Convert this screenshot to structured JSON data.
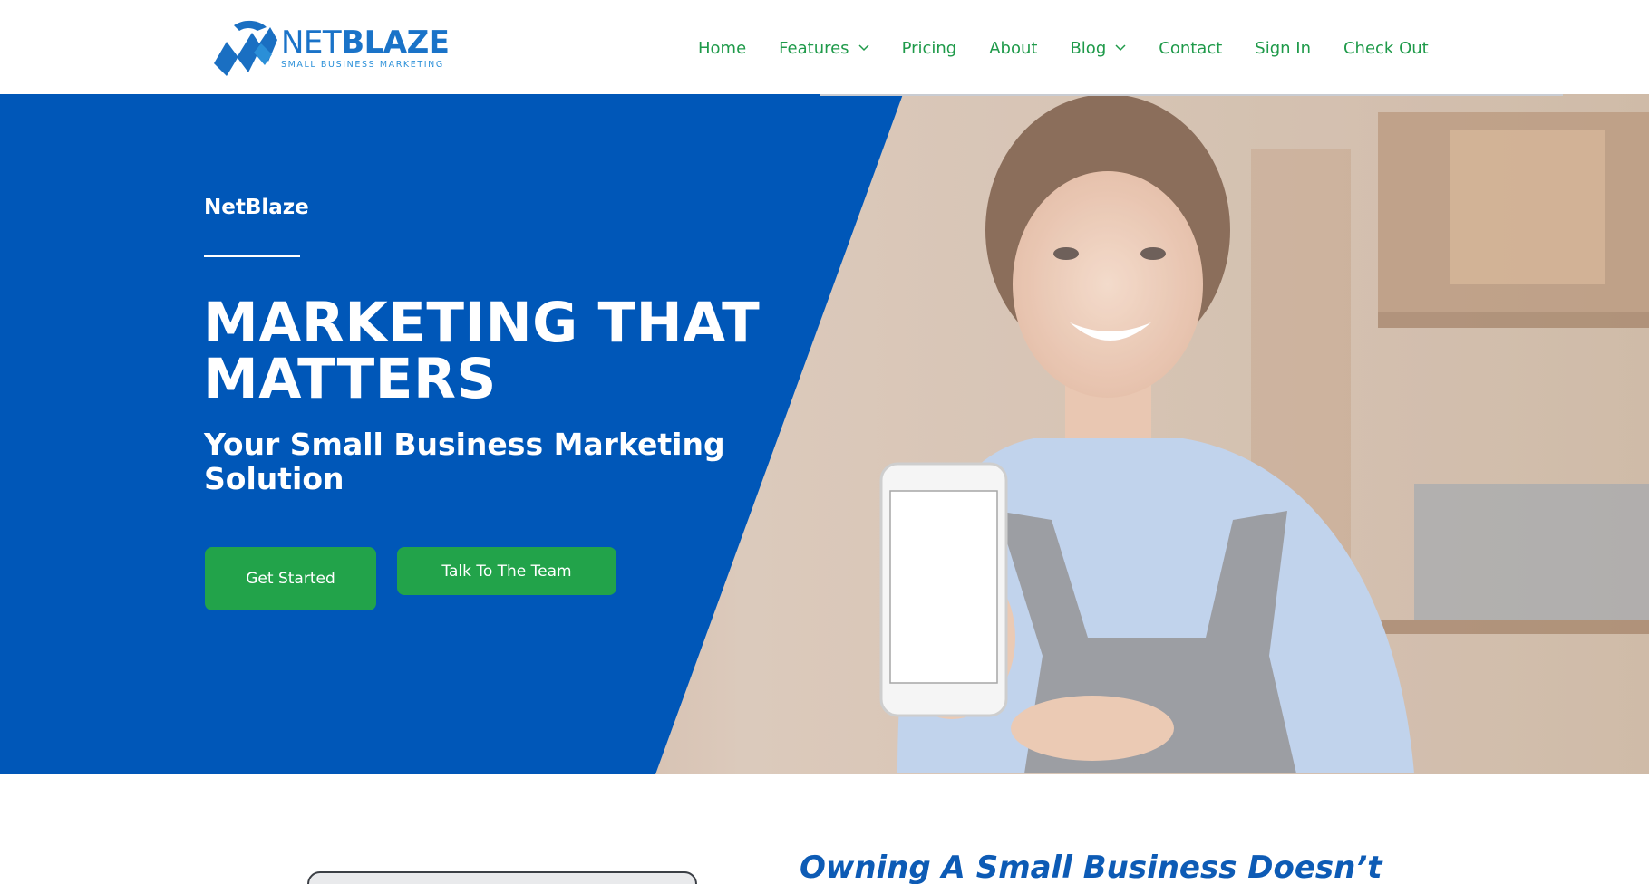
{
  "brand": {
    "name_part1": "NET",
    "name_part2": "BLAZE",
    "tagline": "SMALL BUSINESS MARKETING",
    "icon": "netblaze-logo-icon"
  },
  "nav": {
    "items": [
      {
        "label": "Home",
        "has_dropdown": false
      },
      {
        "label": "Features",
        "has_dropdown": true
      },
      {
        "label": "Pricing",
        "has_dropdown": false
      },
      {
        "label": "About",
        "has_dropdown": false
      },
      {
        "label": "Blog",
        "has_dropdown": true
      },
      {
        "label": "Contact",
        "has_dropdown": false
      },
      {
        "label": "Sign In",
        "has_dropdown": false
      },
      {
        "label": "Check Out",
        "has_dropdown": false
      }
    ],
    "dropdown_icon": "chevron-down-icon"
  },
  "hero": {
    "kicker": "NetBlaze",
    "headline": "MARKETING THAT MATTERS",
    "subhead": "Your Small Business Marketing Solution",
    "primary_button": "Get Started",
    "secondary_button": "Talk To The Team"
  },
  "intro": {
    "heading": "Owning A Small Business Doesn’t"
  },
  "colors": {
    "hero_blue": "#0057b8",
    "button_green": "#22a34a",
    "nav_green": "#1f9a4a",
    "brand_blue": "#1a73c8",
    "heading_blue": "#0d5bb5"
  }
}
